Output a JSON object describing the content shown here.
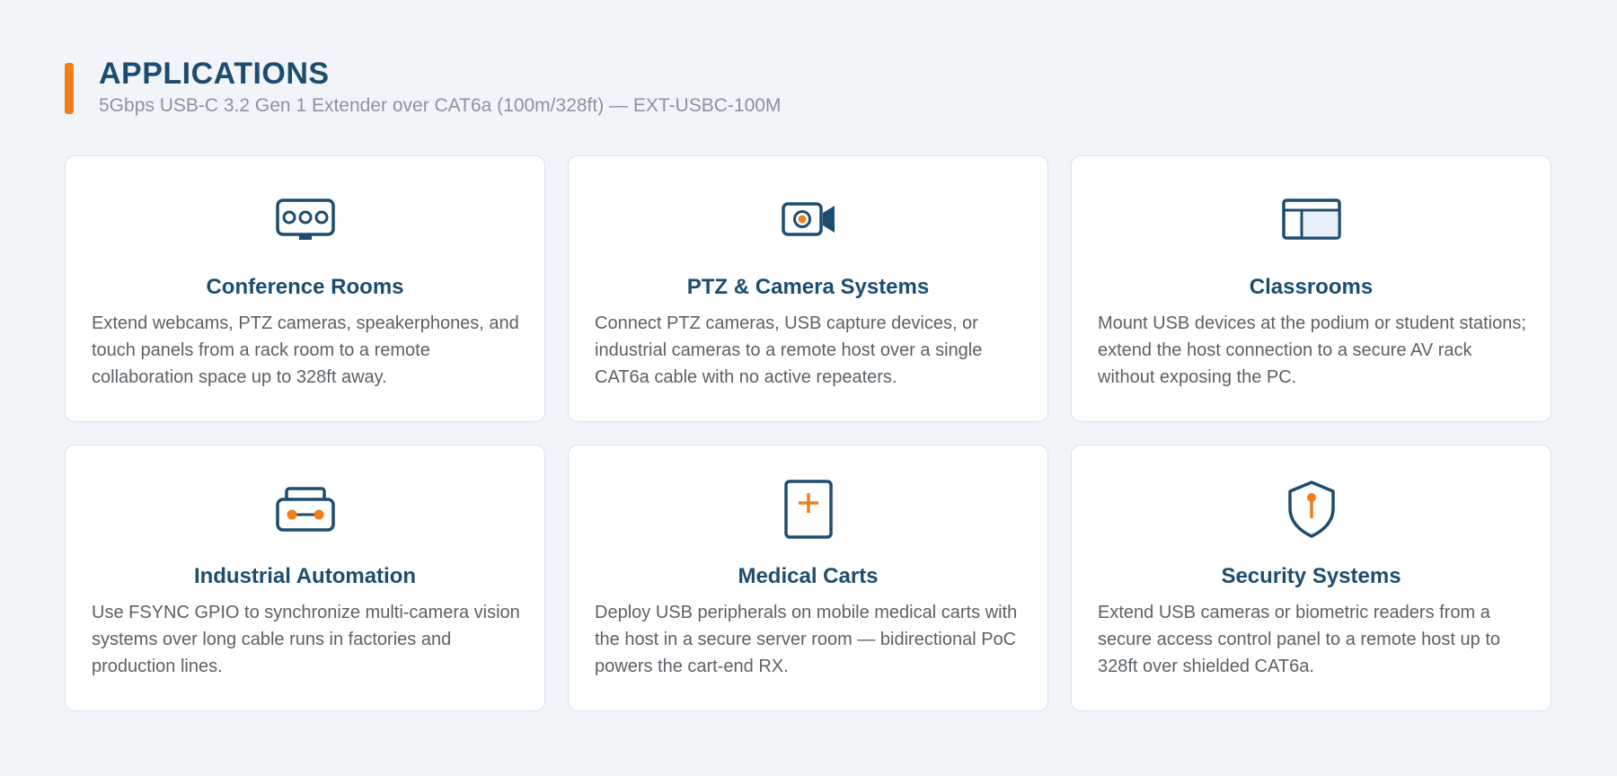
{
  "page": {
    "title": "APPLICATIONS",
    "subtitle": "5Gbps USB-C 3.2 Gen 1 Extender over CAT6a (100m/328ft) — EXT-USBC-100M"
  },
  "colors": {
    "accent": "#f07f1b",
    "navy": "#1c4d70",
    "background": "#f1f5f9",
    "card_border": "#d7e0ef"
  },
  "applications": [
    {
      "icon": "conference-room-icon",
      "title": "Conference Rooms",
      "description": "Extend webcams, PTZ cameras, speakerphones, and touch panels from a rack room to a remote collaboration space up to 328ft away."
    },
    {
      "icon": "camera-icon",
      "title": "PTZ & Camera Systems",
      "description": "Connect PTZ cameras, USB capture devices, or industrial cameras to a remote host over a single CAT6a cable with no active repeaters."
    },
    {
      "icon": "classroom-board-icon",
      "title": "Classrooms",
      "description": "Mount USB devices at the podium or student stations; extend the host connection to a secure AV rack without exposing the PC."
    },
    {
      "icon": "industrial-machine-icon",
      "title": "Industrial Automation",
      "description": "Use FSYNC GPIO to synchronize multi-camera vision systems over long cable runs in factories and production lines."
    },
    {
      "icon": "medical-cross-icon",
      "title": "Medical Carts",
      "description": "Deploy USB peripherals on mobile medical carts with the host in a secure server room — bidirectional PoC powers the cart-end RX."
    },
    {
      "icon": "security-shield-icon",
      "title": "Security Systems",
      "description": "Extend USB cameras or biometric readers from a secure access control panel to a remote host up to 328ft over shielded CAT6a."
    }
  ]
}
